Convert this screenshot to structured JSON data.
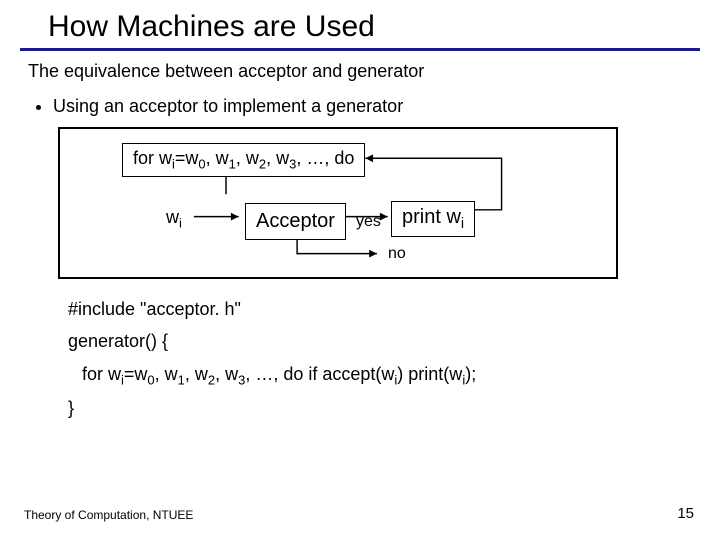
{
  "title": "How Machines are Used",
  "subhead": "The equivalence between acceptor and generator",
  "bullet1": "Using an acceptor to implement a generator",
  "diagram": {
    "for_prefix": "for w",
    "for_sub": "i",
    "for_mid": "=w",
    "for_s0": "0",
    "for_c1": ", w",
    "for_s1": "1",
    "for_c2": ", w",
    "for_s2": "2",
    "for_c3": ", w",
    "for_s3": "3",
    "for_tail": ", …, do",
    "wi_w": "w",
    "wi_i": "i",
    "acceptor": "Acceptor",
    "yes": "yes",
    "no": "no",
    "print_pre": "print w",
    "print_i": "i"
  },
  "code": {
    "l1": "#include \"acceptor. h\"",
    "l2": "generator() {",
    "l3_a": "for w",
    "l3_i": "i",
    "l3_b": "=w",
    "l3_s0": "0",
    "l3_c1": ", w",
    "l3_s1": "1",
    "l3_c2": ", w",
    "l3_s2": "2",
    "l3_c3": ", w",
    "l3_s3": "3",
    "l3_mid": ", …, do if accept(w",
    "l3_is": "i",
    "l3_d": ") print(w",
    "l3_it": "i",
    "l3_e": ");",
    "l4": "}"
  },
  "footer_left": "Theory of Computation, NTUEE",
  "footer_right": "15"
}
